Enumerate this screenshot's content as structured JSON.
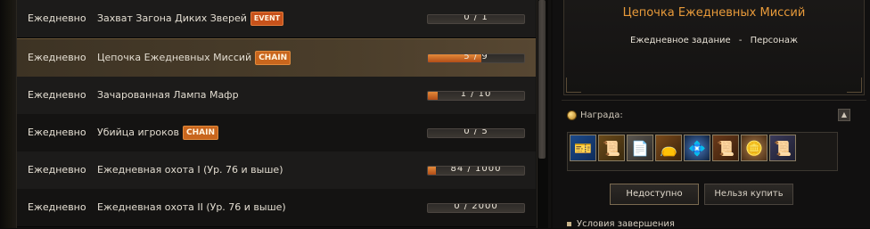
{
  "quests": [
    {
      "type": "Ежедневно",
      "name": "Захват Загона Диких Зверей",
      "badge": "EVENT",
      "progress": "0 / 1",
      "fill": 0.0
    },
    {
      "type": "Ежедневно",
      "name": "Цепочка Ежедневных Миссий",
      "badge": "CHAIN",
      "progress": "5 / 9",
      "fill": 0.556
    },
    {
      "type": "Ежедневно",
      "name": "Зачарованная Лампа Мафр",
      "badge": "",
      "progress": "1 / 10",
      "fill": 0.1
    },
    {
      "type": "Ежедневно",
      "name": "Убийца игроков",
      "badge": "CHAIN",
      "progress": "0 / 5",
      "fill": 0.0
    },
    {
      "type": "Ежедневно",
      "name": "Ежедневная охота I (Ур. 76 и выше)",
      "badge": "",
      "progress": "84 / 1000",
      "fill": 0.084
    },
    {
      "type": "Ежедневно",
      "name": "Ежедневная охота II (Ур. 76 и выше)",
      "badge": "",
      "progress": "0 / 2000",
      "fill": 0.0
    }
  ],
  "detail": {
    "title": "Цепочка Ежедневных Миссий",
    "subtitle_left": "Ежедневное задание",
    "subtitle_sep": "-",
    "subtitle_right": "Персонаж"
  },
  "reward": {
    "label": "Награда:",
    "items": [
      "ticket-icon",
      "scroll-icon",
      "certificate-icon",
      "pouch-icon",
      "crystal-icon",
      "scroll-icon",
      "coin-icon",
      "scroll-icon"
    ]
  },
  "buttons": {
    "unavailable": "Недоступно",
    "cannot_buy": "Нельзя купить"
  },
  "conditions_label": "Условия завершения"
}
